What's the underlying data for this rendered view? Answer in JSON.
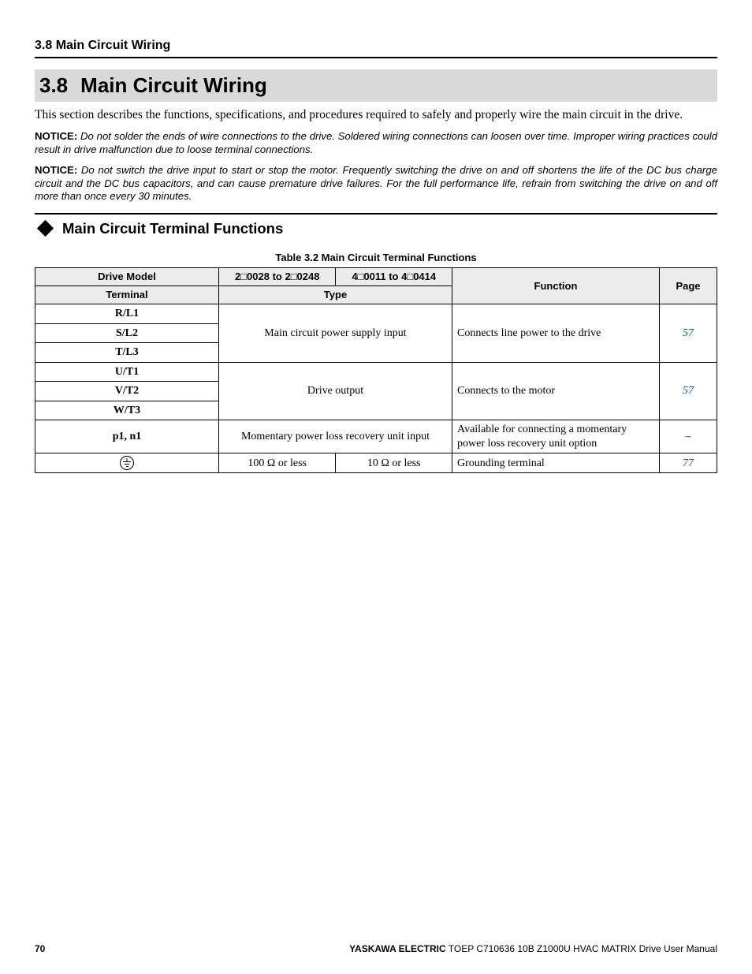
{
  "header": {
    "section_label": "3.8 Main Circuit Wiring"
  },
  "title": {
    "number": "3.8",
    "text": "Main Circuit Wiring"
  },
  "intro": "This section describes the functions, specifications, and procedures required to safely and properly wire the main circuit in the drive.",
  "notices": {
    "label": "NOTICE:",
    "n1": "Do not solder the ends of wire connections to the drive. Soldered wiring connections can loosen over time. Improper wiring practices could result in drive malfunction due to loose terminal connections.",
    "n2": "Do not switch the drive input to start or stop the motor. Frequently switching the drive on and off shortens the life of the DC bus charge circuit and the DC bus capacitors, and can cause premature drive failures. For the full performance life, refrain from switching the drive on and off more than once every 30 minutes."
  },
  "subheading": "Main Circuit Terminal Functions",
  "table": {
    "caption": "Table 3.2  Main Circuit Terminal Functions",
    "head": {
      "drive_model": "Drive Model",
      "model_a": "2□0028 to 2□0248",
      "model_b": "4□0011 to 4□0414",
      "function": "Function",
      "page": "Page",
      "terminal": "Terminal",
      "type": "Type"
    },
    "rows": {
      "r_l1": "R/L1",
      "s_l2": "S/L2",
      "t_l3": "T/L3",
      "power_supply_type": "Main circuit power supply input",
      "power_supply_func": "Connects line power to the drive",
      "power_supply_page": "57",
      "u_t1": "U/T1",
      "v_t2": "V/T2",
      "w_t3": "W/T3",
      "drive_output_type": "Drive output",
      "drive_output_func": "Connects to the motor",
      "drive_output_page": "57",
      "p1_n1": "p1, n1",
      "momentary_type": "Momentary power loss recovery unit input",
      "momentary_func": "Available for connecting a momentary power loss recovery unit option",
      "momentary_page": "–",
      "ground_a": "100 Ω or less",
      "ground_b": "10 Ω or less",
      "ground_func": "Grounding terminal",
      "ground_page": "77"
    }
  },
  "footer": {
    "page_number": "70",
    "brand": "YASKAWA ELECTRIC",
    "manual": " TOEP C710636 10B Z1000U HVAC MATRIX Drive User Manual"
  }
}
